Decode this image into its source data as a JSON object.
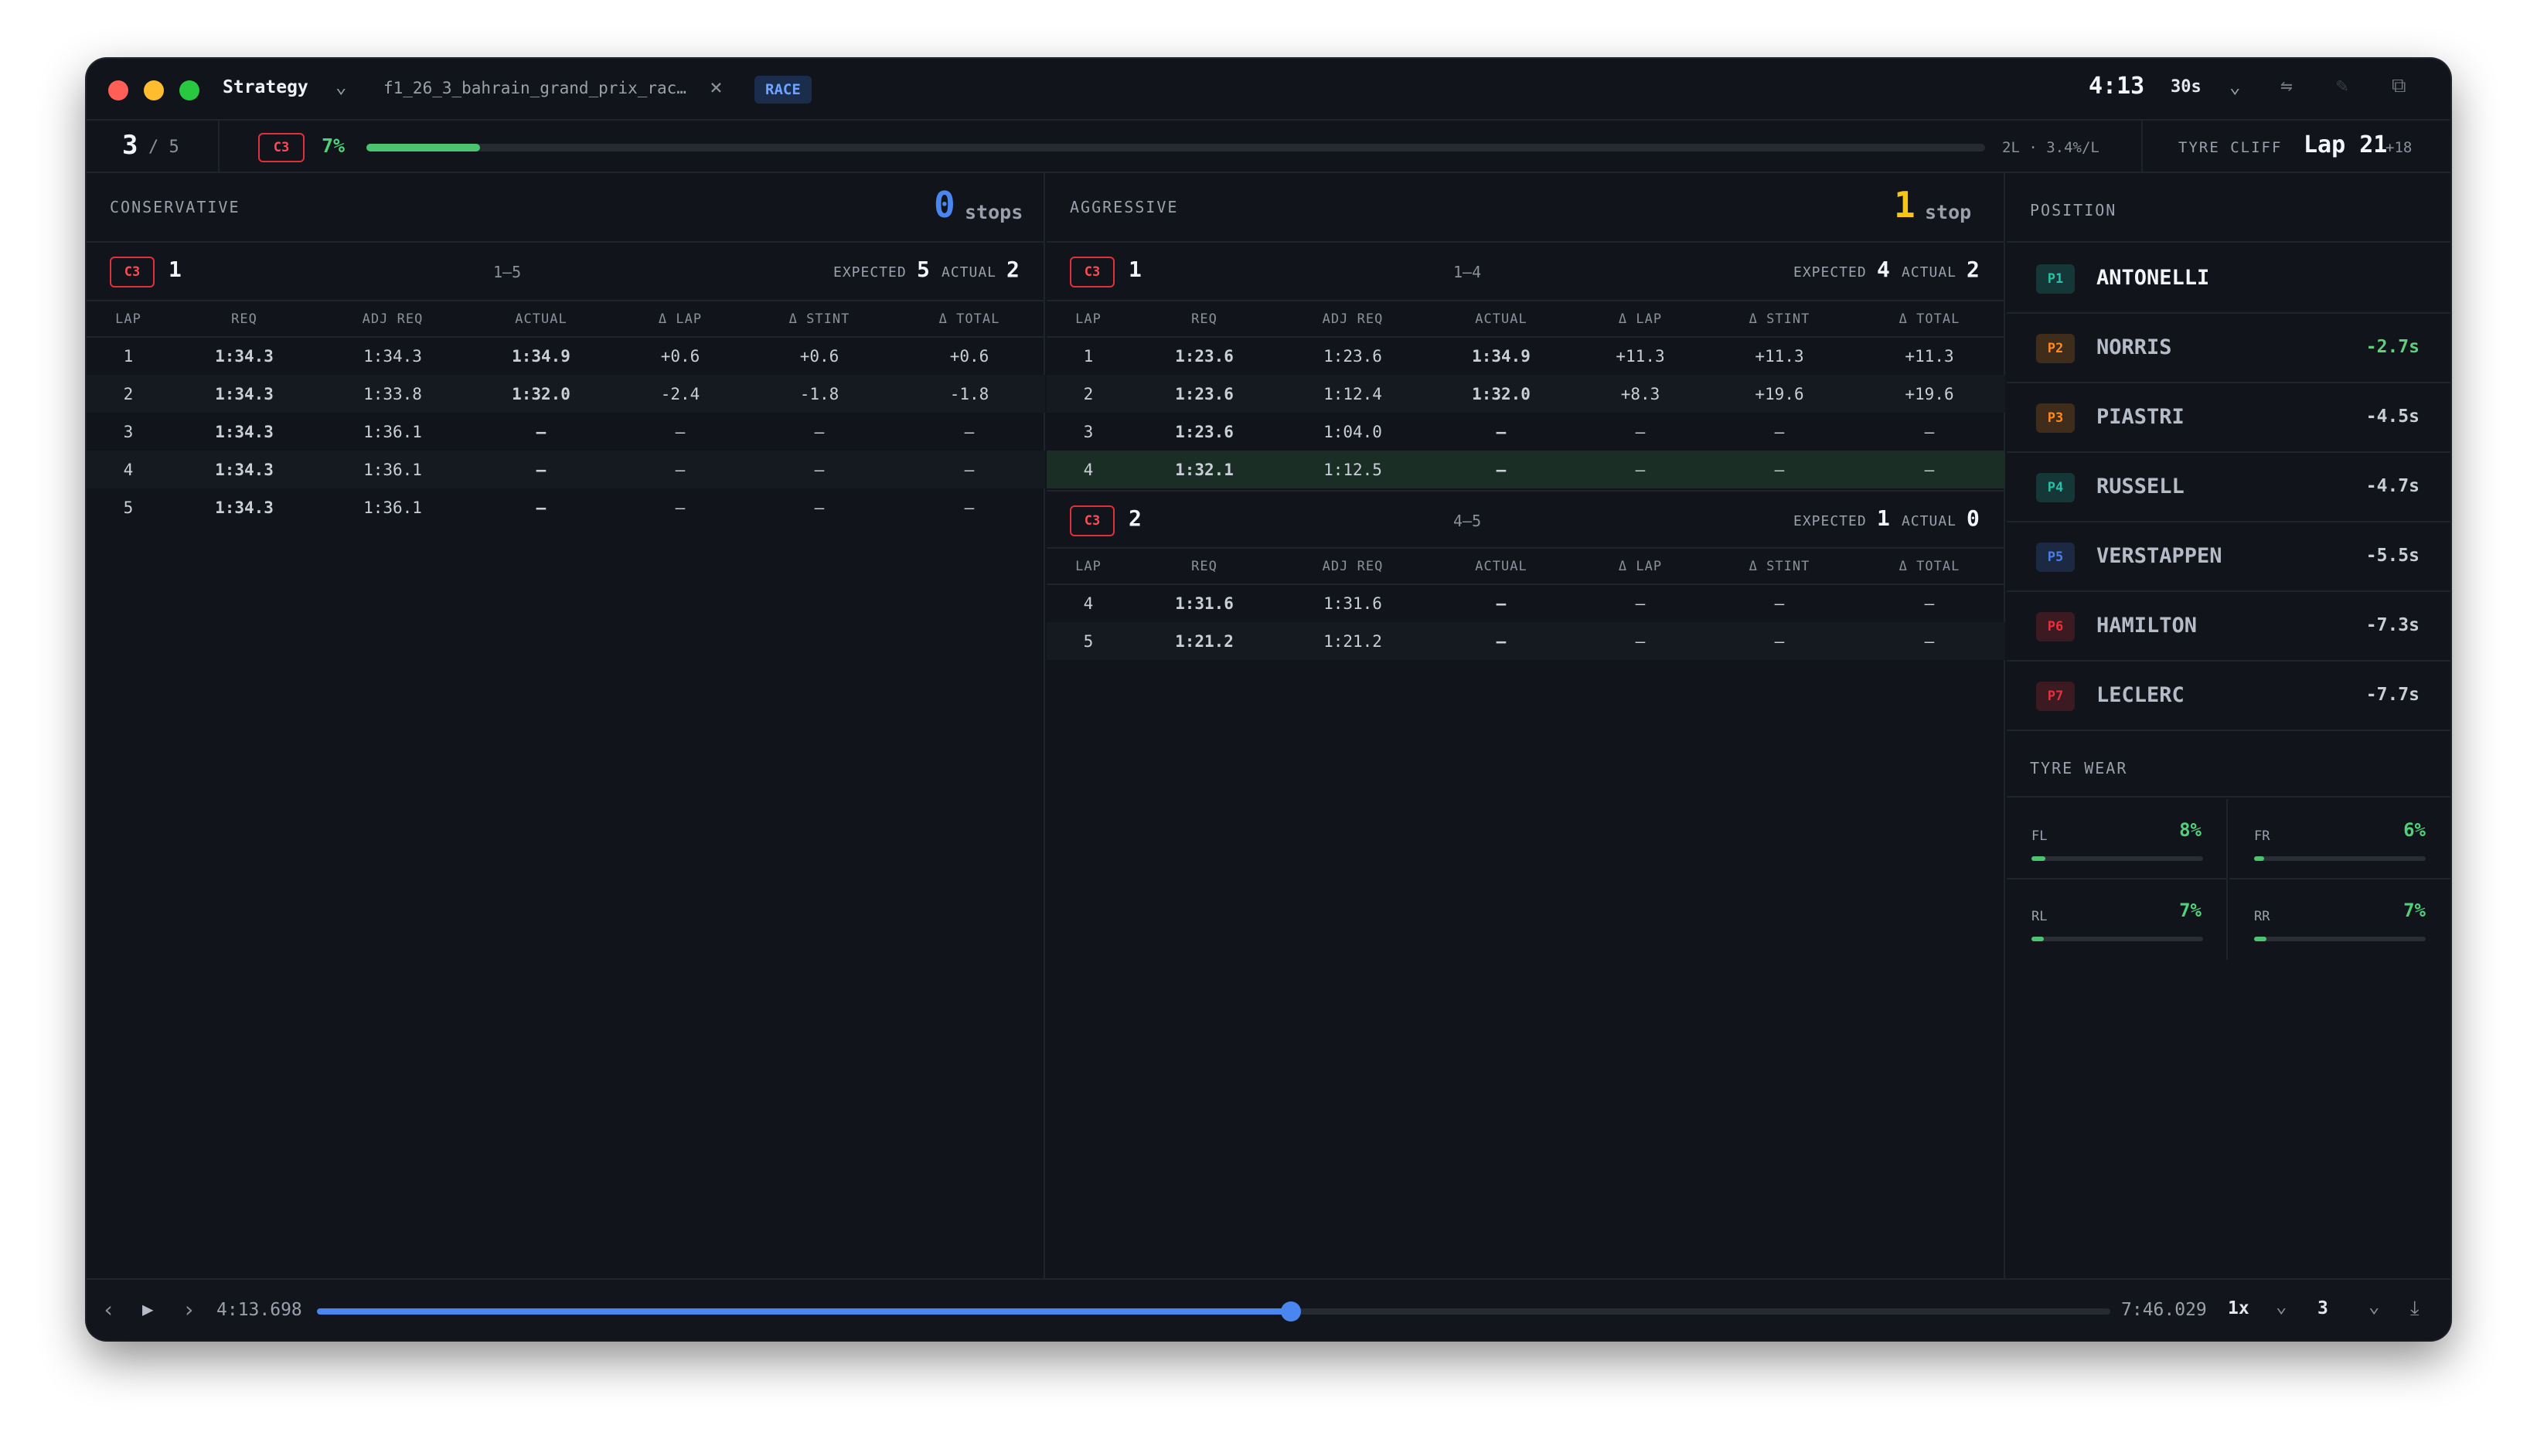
{
  "titlebar": {
    "app_title": "Strategy",
    "file_tab": "f1_26_3_bahrain_grand_prix_rac…",
    "session_badge": "RACE",
    "clock": "4:13",
    "interval": "30s"
  },
  "progress": {
    "lap_current": "3",
    "lap_total": "/ 5",
    "compound": "C3",
    "percent_label": "7%",
    "percent_value": 7,
    "fuel_info": "2L · 3.4%/L",
    "cliff_label": "TYRE CLIFF",
    "cliff_lap": "Lap 21",
    "cliff_extra": "+18"
  },
  "conservative": {
    "title": "CONSERVATIVE",
    "stops_count": "0",
    "stops_label": "stops",
    "stints": [
      {
        "compound": "C3",
        "number": "1",
        "range": "1–5",
        "expected_label": "EXPECTED",
        "expected": "5",
        "actual_label": "ACTUAL",
        "actual": "2",
        "columns": [
          "LAP",
          "REQ",
          "ADJ REQ",
          "ACTUAL",
          "Δ LAP",
          "Δ STINT",
          "Δ TOTAL"
        ],
        "rows": [
          [
            "1",
            "1:34.3",
            "1:34.3",
            "1:34.9",
            "+0.6",
            "+0.6",
            "+0.6"
          ],
          [
            "2",
            "1:34.3",
            "1:33.8",
            "1:32.0",
            "-2.4",
            "-1.8",
            "-1.8"
          ],
          [
            "3",
            "1:34.3",
            "1:36.1",
            "—",
            "—",
            "—",
            "—"
          ],
          [
            "4",
            "1:34.3",
            "1:36.1",
            "—",
            "—",
            "—",
            "—"
          ],
          [
            "5",
            "1:34.3",
            "1:36.1",
            "—",
            "—",
            "—",
            "—"
          ]
        ]
      }
    ]
  },
  "aggressive": {
    "title": "AGGRESSIVE",
    "stops_count": "1",
    "stops_label": "stop",
    "stints": [
      {
        "compound": "C3",
        "number": "1",
        "range": "1–4",
        "expected_label": "EXPECTED",
        "expected": "4",
        "actual_label": "ACTUAL",
        "actual": "2",
        "columns": [
          "LAP",
          "REQ",
          "ADJ REQ",
          "ACTUAL",
          "Δ LAP",
          "Δ STINT",
          "Δ TOTAL"
        ],
        "rows": [
          [
            "1",
            "1:23.6",
            "1:23.6",
            "1:34.9",
            "+11.3",
            "+11.3",
            "+11.3"
          ],
          [
            "2",
            "1:23.6",
            "1:12.4",
            "1:32.0",
            "+8.3",
            "+19.6",
            "+19.6"
          ],
          [
            "3",
            "1:23.6",
            "1:04.0",
            "—",
            "—",
            "—",
            "—"
          ],
          [
            "4",
            "1:32.1",
            "1:12.5",
            "—",
            "—",
            "—",
            "—"
          ]
        ]
      },
      {
        "compound": "C3",
        "number": "2",
        "range": "4–5",
        "expected_label": "EXPECTED",
        "expected": "1",
        "actual_label": "ACTUAL",
        "actual": "0",
        "columns": [
          "LAP",
          "REQ",
          "ADJ REQ",
          "ACTUAL",
          "Δ LAP",
          "Δ STINT",
          "Δ TOTAL"
        ],
        "rows": [
          [
            "4",
            "1:31.6",
            "1:31.6",
            "—",
            "—",
            "—",
            "—"
          ],
          [
            "5",
            "1:21.2",
            "1:21.2",
            "—",
            "—",
            "—",
            "—"
          ]
        ]
      }
    ]
  },
  "position": {
    "title": "POSITION",
    "drivers": [
      {
        "pos": "P1",
        "name": "ANTONELLI",
        "gap": "",
        "team_color": "#27c1a8"
      },
      {
        "pos": "P2",
        "name": "NORRIS",
        "gap": "-2.7s",
        "team_color": "#ff8a1f"
      },
      {
        "pos": "P3",
        "name": "PIASTRI",
        "gap": "-4.5s",
        "team_color": "#ff8a1f"
      },
      {
        "pos": "P4",
        "name": "RUSSELL",
        "gap": "-4.7s",
        "team_color": "#27c1a8"
      },
      {
        "pos": "P5",
        "name": "VERSTAPPEN",
        "gap": "-5.5s",
        "team_color": "#4a7de8"
      },
      {
        "pos": "P6",
        "name": "HAMILTON",
        "gap": "-7.3s",
        "team_color": "#e8303c"
      },
      {
        "pos": "P7",
        "name": "LECLERC",
        "gap": "-7.7s",
        "team_color": "#e8303c"
      }
    ]
  },
  "tyre_wear": {
    "title": "TYRE WEAR",
    "tyres": [
      {
        "label": "FL",
        "value": "8%",
        "pct": 8
      },
      {
        "label": "FR",
        "value": "6%",
        "pct": 6
      },
      {
        "label": "RL",
        "value": "7%",
        "pct": 7
      },
      {
        "label": "RR",
        "value": "7%",
        "pct": 7
      }
    ]
  },
  "playback": {
    "current_time": "4:13.698",
    "total_time": "7:46.029",
    "progress_fraction": 0.543,
    "speed": "1x",
    "lap_select": "3"
  },
  "colors": {
    "accent_blue": "#4a86f0",
    "green": "#4fd17a",
    "red": "#f0495a",
    "stops_zero": "#4a86f0",
    "stops_one": "#f5c518"
  }
}
